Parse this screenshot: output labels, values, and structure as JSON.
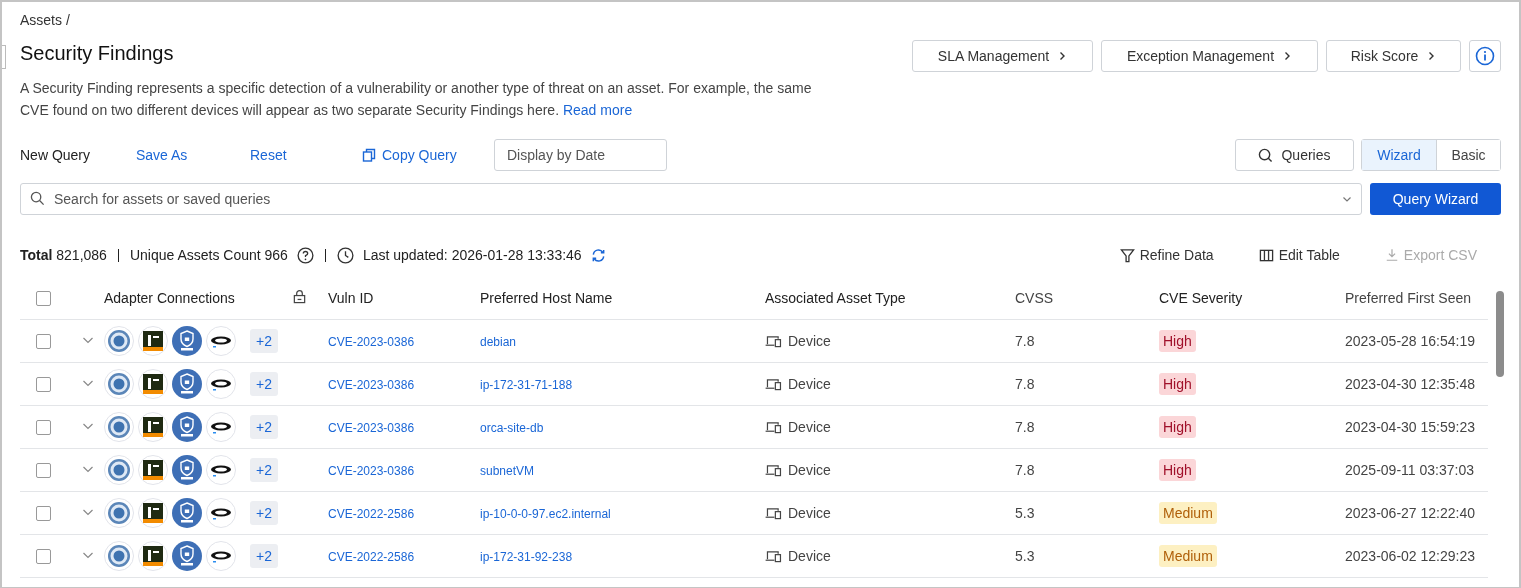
{
  "breadcrumb": "Assets /",
  "title": "Security Findings",
  "description": "A Security Finding represents a specific detection of a vulnerability or another type of threat on an asset. For example, the same CVE found on two different devices will appear as two separate Security Findings here.",
  "read_more": "Read more",
  "header_buttons": [
    "SLA Management",
    "Exception Management",
    "Risk Score"
  ],
  "query_bar": {
    "new_query": "New Query",
    "save_as": "Save As",
    "reset": "Reset",
    "copy_query": "Copy Query",
    "date_placeholder": "Display by Date",
    "queries": "Queries",
    "modes": [
      {
        "label": "Wizard",
        "selected": true
      },
      {
        "label": "Basic",
        "selected": false
      }
    ]
  },
  "search": {
    "placeholder": "Search for assets or saved queries"
  },
  "query_wizard": "Query Wizard",
  "summary": {
    "total_label": "Total",
    "total": "821,086",
    "unique_label": "Unique Assets Count 966",
    "updated_label": "Last updated:",
    "updated": "2026-01-28 13:33:46"
  },
  "table_actions": [
    {
      "label": "Refine Data",
      "disabled": false,
      "kind": "filter"
    },
    {
      "label": "Edit Table",
      "disabled": false,
      "kind": "columns"
    },
    {
      "label": "Export CSV",
      "disabled": true,
      "kind": "download"
    }
  ],
  "table": {
    "select_all": false,
    "columns": [
      "Adapter Connections",
      "Vuln ID",
      "Preferred Host Name",
      "Associated Asset Type",
      "CVSS",
      "CVE Severity",
      "Preferred First Seen"
    ],
    "rows": [
      {
        "checked": false,
        "more": "+2",
        "vuln": "CVE-2023-0386",
        "host": "debian",
        "asset_type": "Device",
        "cvss": "7.8",
        "severity": "High",
        "kind": "high",
        "first_seen": "2023-05-28 16:54:19"
      },
      {
        "checked": false,
        "more": "+2",
        "vuln": "CVE-2023-0386",
        "host": "ip-172-31-71-188",
        "asset_type": "Device",
        "cvss": "7.8",
        "severity": "High",
        "kind": "high",
        "first_seen": "2023-04-30 12:35:48"
      },
      {
        "checked": false,
        "more": "+2",
        "vuln": "CVE-2023-0386",
        "host": "orca-site-db",
        "asset_type": "Device",
        "cvss": "7.8",
        "severity": "High",
        "kind": "high",
        "first_seen": "2023-04-30 15:59:23"
      },
      {
        "checked": false,
        "more": "+2",
        "vuln": "CVE-2023-0386",
        "host": "subnetVM",
        "asset_type": "Device",
        "cvss": "7.8",
        "severity": "High",
        "kind": "high",
        "first_seen": "2025-09-11 03:37:03"
      },
      {
        "checked": false,
        "more": "+2",
        "vuln": "CVE-2022-2586",
        "host": "ip-10-0-0-97.ec2.internal",
        "asset_type": "Device",
        "cvss": "5.3",
        "severity": "Medium",
        "kind": "medium",
        "first_seen": "2023-06-27 12:22:40"
      },
      {
        "checked": false,
        "more": "+2",
        "vuln": "CVE-2022-2586",
        "host": "ip-172-31-92-238",
        "asset_type": "Device",
        "cvss": "5.3",
        "severity": "Medium",
        "kind": "medium",
        "first_seen": "2023-06-02 12:29:23"
      }
    ]
  }
}
